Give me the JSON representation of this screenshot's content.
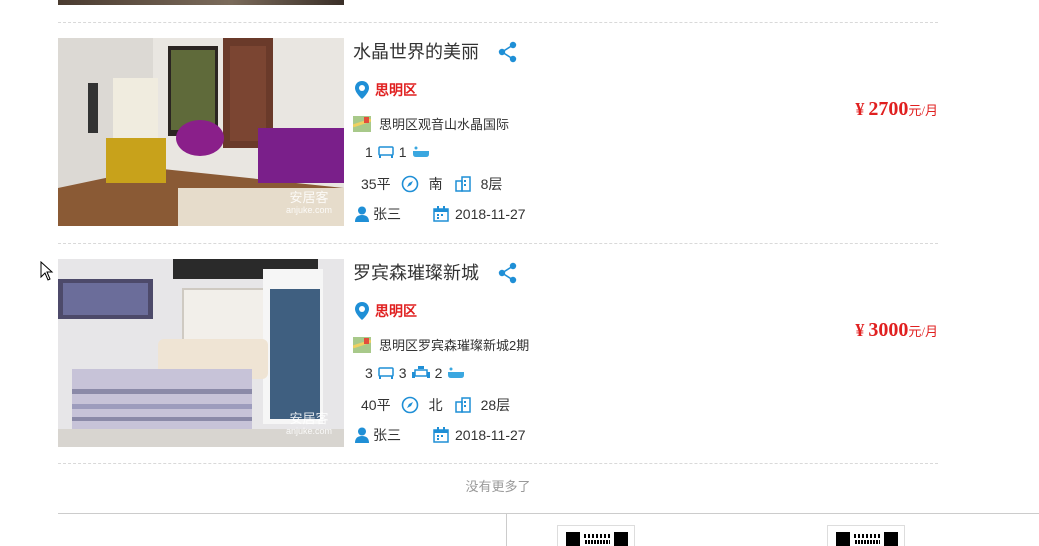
{
  "listings": [
    {
      "title": "水晶世界的美丽",
      "district": "思明区",
      "address": "思明区观音山水晶国际",
      "bedrooms": "1",
      "livingrooms": "",
      "bathrooms": "1",
      "area": "35平",
      "orientation": "南",
      "floor": "8层",
      "agent": "张三",
      "date": "2018-11-27",
      "price_currency": "¥",
      "price": "2700",
      "price_unit": "元/月",
      "watermark": "安居客",
      "watermark_sub": "anjuke.com"
    },
    {
      "title": "罗宾森璀璨新城",
      "district": "思明区",
      "address": "思明区罗宾森璀璨新城2期",
      "bedrooms": "3",
      "livingrooms": "3",
      "bathrooms": "2",
      "area": "40平",
      "orientation": "北",
      "floor": "28层",
      "agent": "张三",
      "date": "2018-11-27",
      "price_currency": "¥",
      "price": "3000",
      "price_unit": "元/月",
      "watermark": "安居客",
      "watermark_sub": "anjuke.com"
    }
  ],
  "footer_note": "没有更多了",
  "colors": {
    "accent": "#e02020",
    "icon": "#1f8fd6",
    "text": "#333333",
    "muted": "#999999"
  }
}
